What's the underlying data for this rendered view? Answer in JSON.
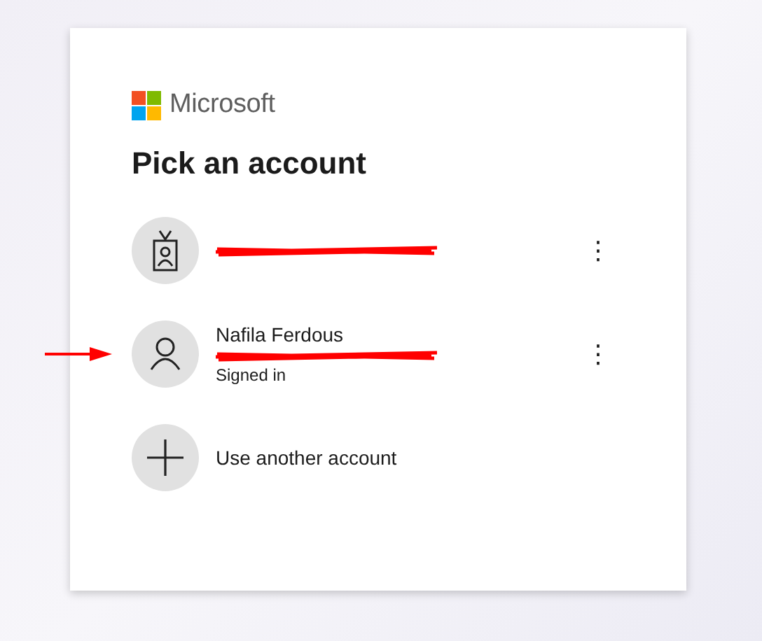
{
  "brand": {
    "name": "Microsoft"
  },
  "heading": "Pick an account",
  "accounts": [
    {
      "kind": "work",
      "email_redacted": true,
      "menu": "⋮",
      "pointed": false
    },
    {
      "kind": "personal",
      "name": "Nafila Ferdous",
      "email_redacted": true,
      "status": "Signed in",
      "menu": "⋮",
      "pointed": true
    }
  ],
  "other_option": {
    "label": "Use another account"
  }
}
